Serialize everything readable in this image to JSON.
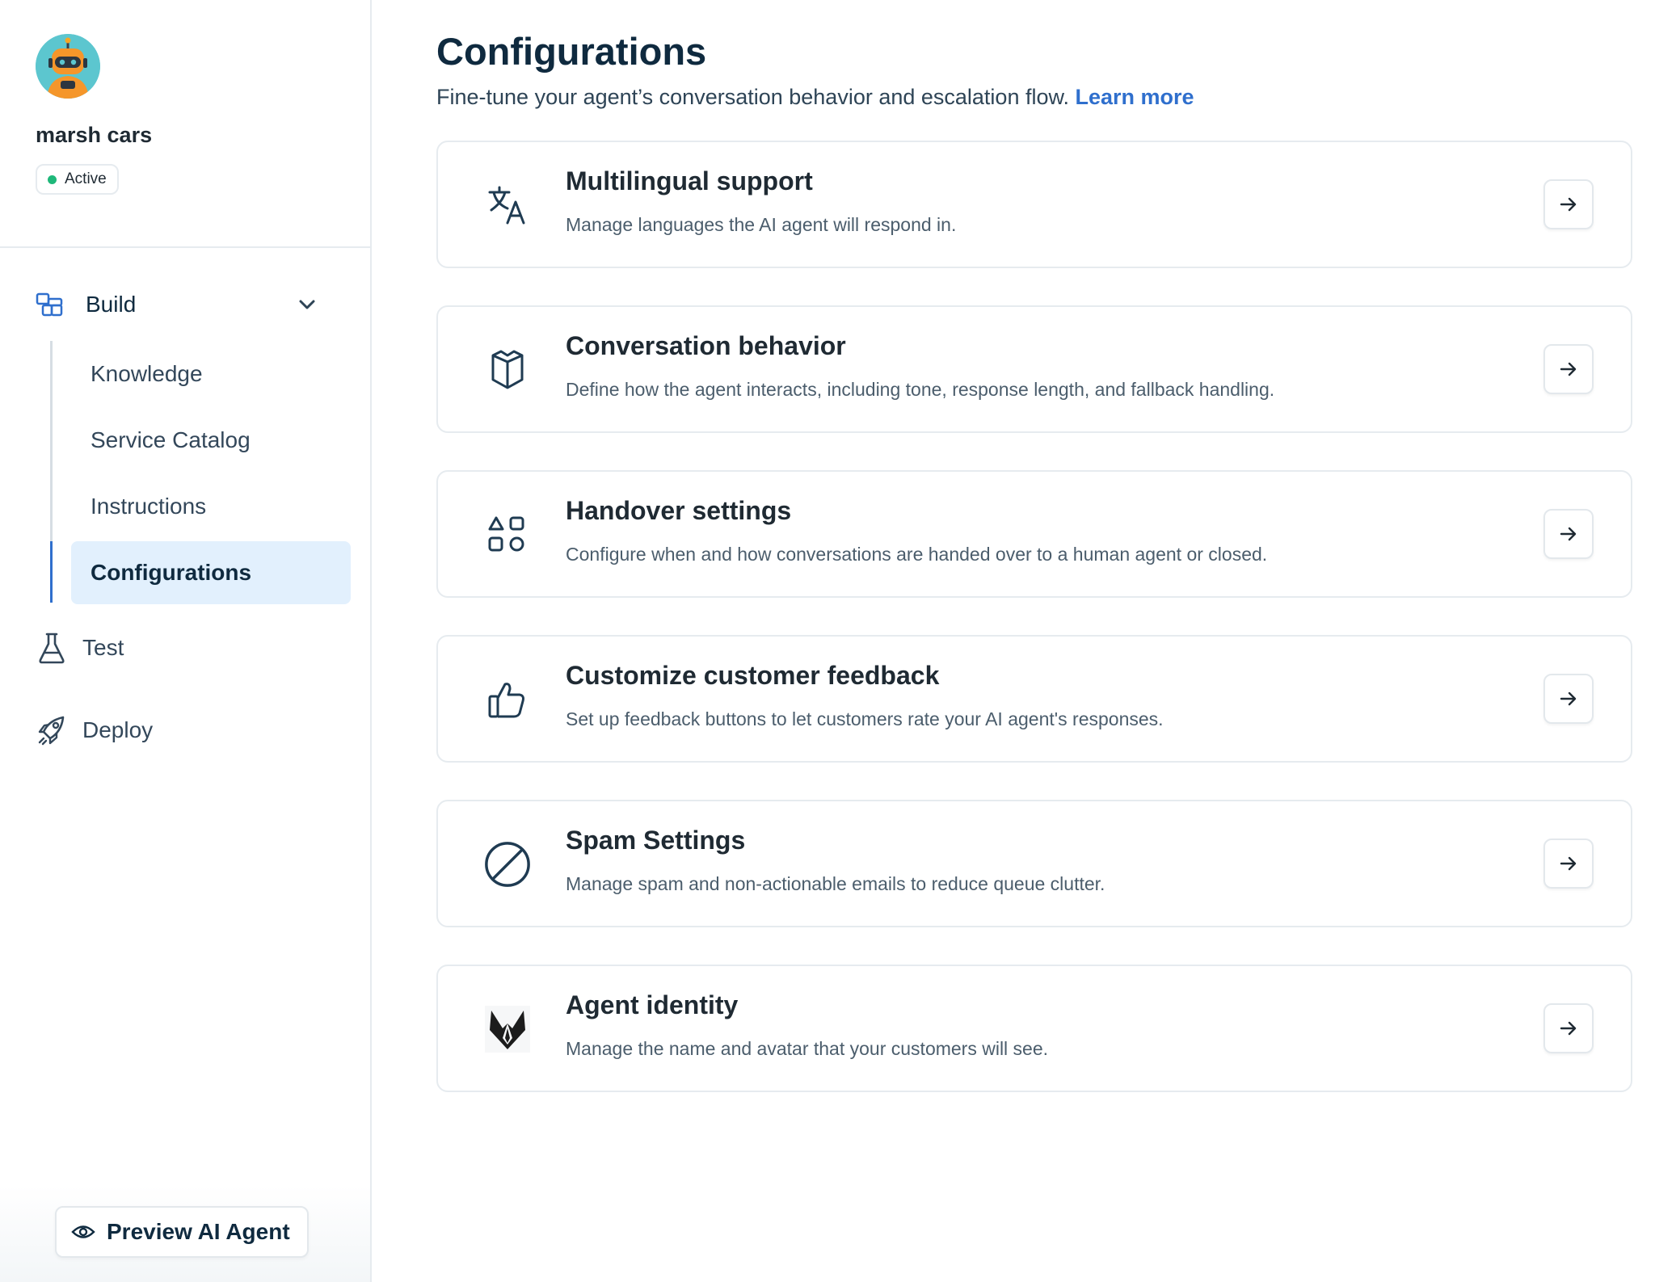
{
  "agent": {
    "name": "marsh cars",
    "status": "Active",
    "status_color": "#1fb87a",
    "avatar_icon": "robot-avatar"
  },
  "nav": {
    "build_label": "Build",
    "build_items": [
      {
        "label": "Knowledge",
        "active": false
      },
      {
        "label": "Service Catalog",
        "active": false
      },
      {
        "label": "Instructions",
        "active": false
      },
      {
        "label": "Configurations",
        "active": true
      }
    ],
    "test_label": "Test",
    "deploy_label": "Deploy",
    "preview_label": "Preview AI Agent"
  },
  "page": {
    "title": "Configurations",
    "subtitle": "Fine-tune your agent’s conversation behavior and escalation flow.",
    "learn_more": "Learn more"
  },
  "cards": [
    {
      "title": "Multilingual support",
      "desc": "Manage languages the AI agent will respond in.",
      "icon": "translate-icon"
    },
    {
      "title": "Conversation behavior",
      "desc": "Define how the agent interacts, including tone, response length, and fallback handling.",
      "icon": "box-icon"
    },
    {
      "title": "Handover settings",
      "desc": "Configure when and how conversations are handed over to a human agent or closed.",
      "icon": "shapes-icon"
    },
    {
      "title": "Customize customer feedback",
      "desc": "Set up feedback buttons to let customers rate your AI agent's responses.",
      "icon": "thumbs-up-icon"
    },
    {
      "title": "Spam Settings",
      "desc": "Manage spam and non-actionable emails to reduce queue clutter.",
      "icon": "block-icon"
    },
    {
      "title": "Agent identity",
      "desc": "Manage the name and avatar that your customers will see.",
      "icon": "fox-icon"
    }
  ],
  "colors": {
    "accent": "#2f6fcd",
    "active_bg": "#e2f0fd",
    "text_dark": "#0f2a3f"
  }
}
